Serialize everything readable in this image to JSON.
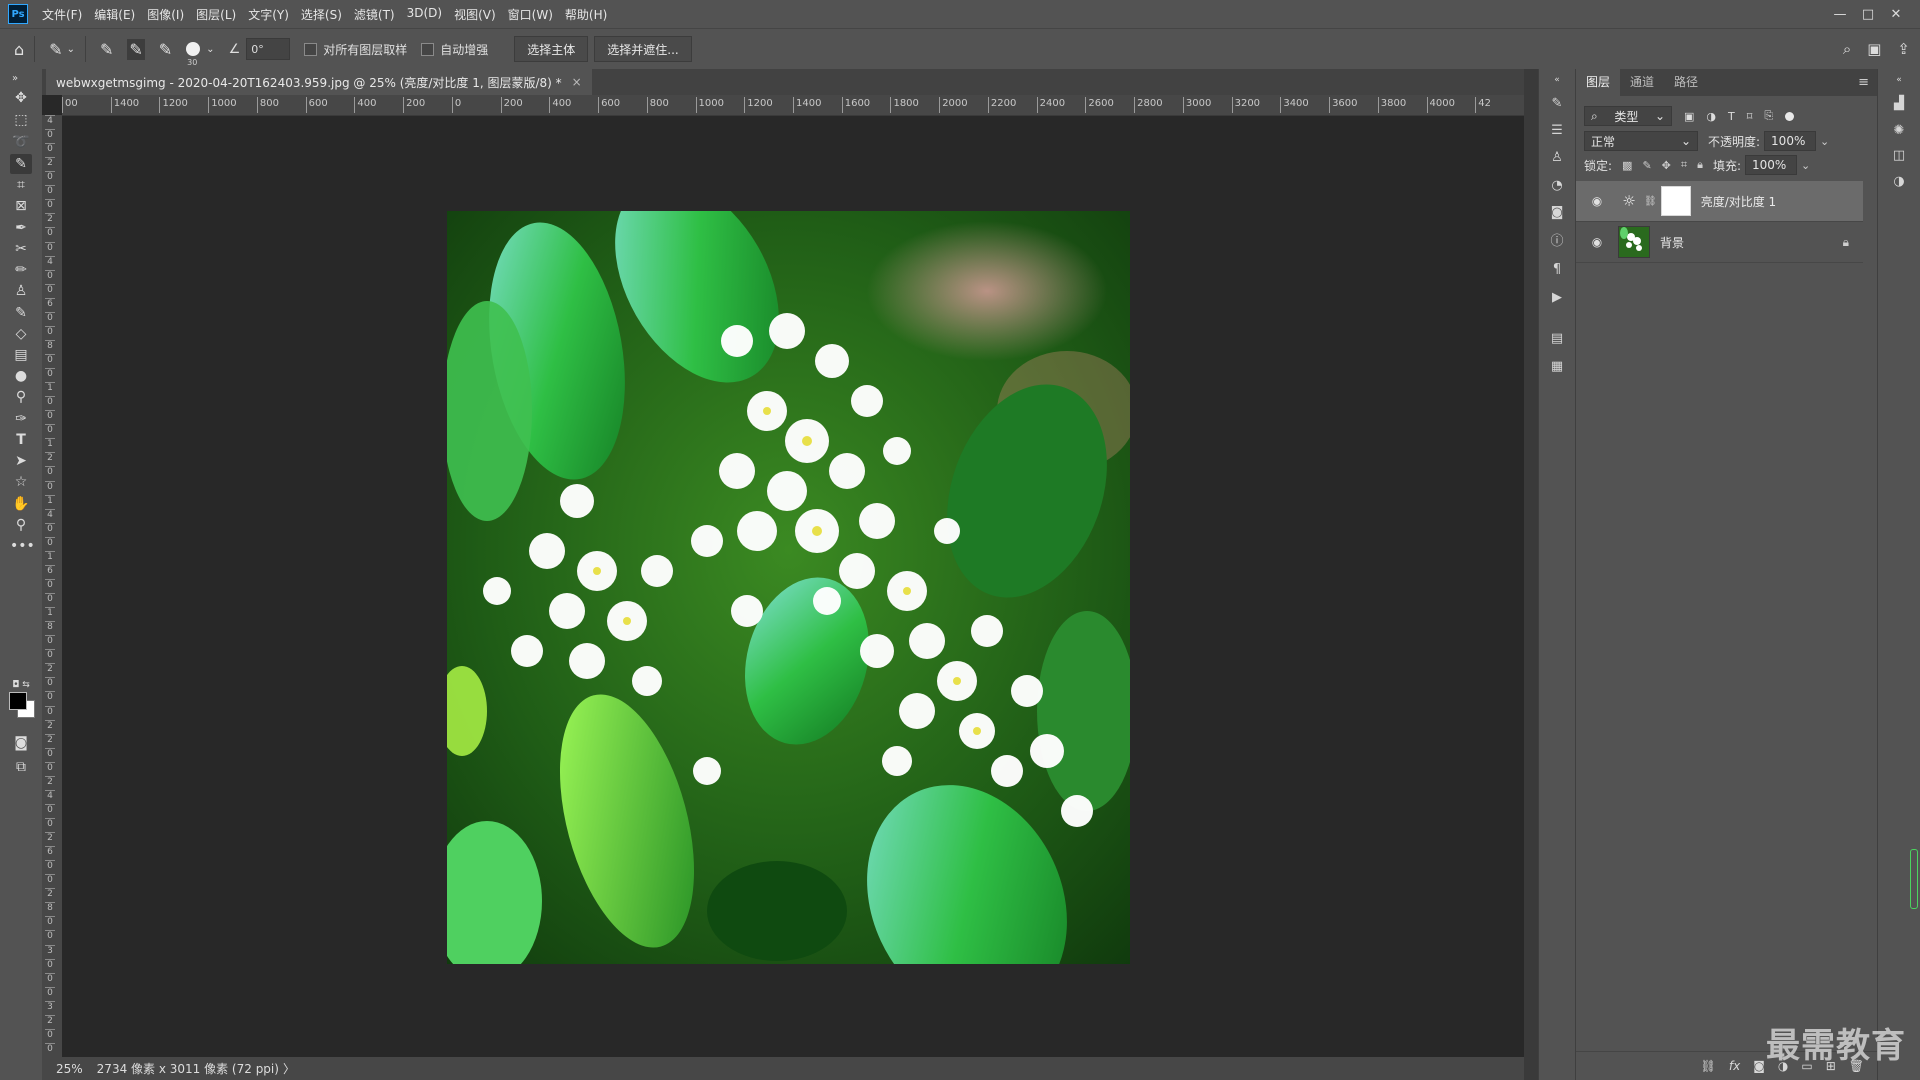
{
  "app": {
    "logo": "Ps"
  },
  "menu": [
    "文件(F)",
    "编辑(E)",
    "图像(I)",
    "图层(L)",
    "文字(Y)",
    "选择(S)",
    "滤镜(T)",
    "3D(D)",
    "视图(V)",
    "窗口(W)",
    "帮助(H)"
  ],
  "window_controls": [
    "—",
    "□",
    "✕"
  ],
  "options_bar": {
    "brush_size": "30",
    "angle": "0°",
    "sample_all_layers": "对所有图层取样",
    "auto_enhance": "自动增强",
    "select_subject": "选择主体",
    "select_and_mask": "选择并遮住..."
  },
  "document": {
    "tab_title": "webwxgetmsgimg - 2020-04-20T162403.959.jpg @ 25% (亮度/对比度 1, 图层蒙版/8) *",
    "close": "×"
  },
  "rulers": {
    "horizontal": [
      "00",
      "1400",
      "1200",
      "1000",
      "800",
      "600",
      "400",
      "200",
      "0",
      "200",
      "400",
      "600",
      "800",
      "1000",
      "1200",
      "1400",
      "1600",
      "1800",
      "2000",
      "2200",
      "2400",
      "2600",
      "2800",
      "3000",
      "3200",
      "3400",
      "3600",
      "3800",
      "4000",
      "42"
    ],
    "vertical": [
      "4",
      "0",
      "0",
      "2",
      "0",
      "0",
      "0",
      "2",
      "0",
      "0",
      "4",
      "0",
      "0",
      "6",
      "0",
      "0",
      "8",
      "0",
      "0",
      "1",
      "0",
      "0",
      "0",
      "1",
      "2",
      "0",
      "0",
      "1",
      "4",
      "0",
      "0",
      "1",
      "6",
      "0",
      "0",
      "1",
      "8",
      "0",
      "0",
      "2",
      "0",
      "0",
      "0",
      "2",
      "2",
      "0",
      "0",
      "2",
      "4",
      "0",
      "0",
      "2",
      "6",
      "0",
      "0",
      "2",
      "8",
      "0",
      "0",
      "3",
      "0",
      "0",
      "0",
      "3",
      "2",
      "0",
      "0"
    ]
  },
  "status": {
    "zoom": "25%",
    "doc_size": "2734 像素 x 3011 像素 (72 ppi)",
    "arrow": "〉"
  },
  "layers_panel": {
    "tabs": [
      "图层",
      "通道",
      "路径"
    ],
    "filter_type": "类型",
    "blend_mode": "正常",
    "opacity_label": "不透明度:",
    "opacity_value": "100%",
    "lock_label": "锁定:",
    "fill_label": "填充:",
    "fill_value": "100%",
    "layers": [
      {
        "name": "亮度/对比度 1",
        "selected": true,
        "kind": "adjustment"
      },
      {
        "name": "背景",
        "selected": false,
        "kind": "image",
        "locked": true
      }
    ]
  },
  "watermark": "最需教育",
  "colors": {
    "foreground": "#000000",
    "background": "#ffffff",
    "accent": "#31a8ff"
  }
}
